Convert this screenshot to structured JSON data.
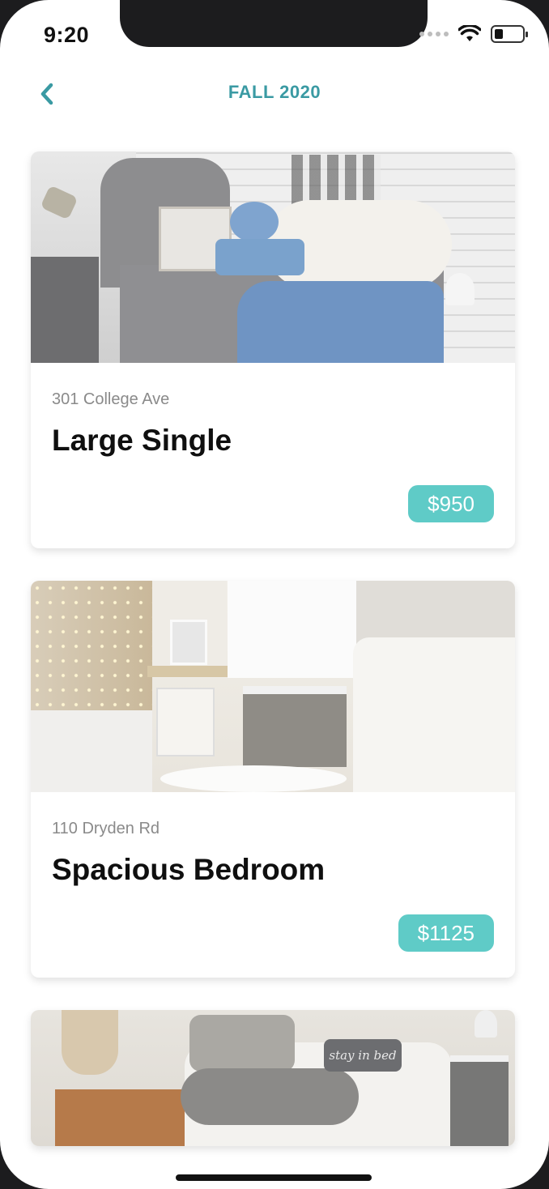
{
  "status_bar": {
    "time": "9:20"
  },
  "nav": {
    "title": "FALL 2020",
    "back_icon": "chevron-left-icon"
  },
  "colors": {
    "accent": "#3a9aa3",
    "price_badge": "#5fcbc7",
    "title_text": "#0f0f0f",
    "address_text": "#8a8a8a"
  },
  "listings": [
    {
      "address": "301 College Ave",
      "title": "Large Single",
      "price": "$950"
    },
    {
      "address": "110 Dryden Rd",
      "title": "Spacious Bedroom",
      "price": "$1125"
    },
    {
      "pillow_text": "stay in bed"
    }
  ]
}
